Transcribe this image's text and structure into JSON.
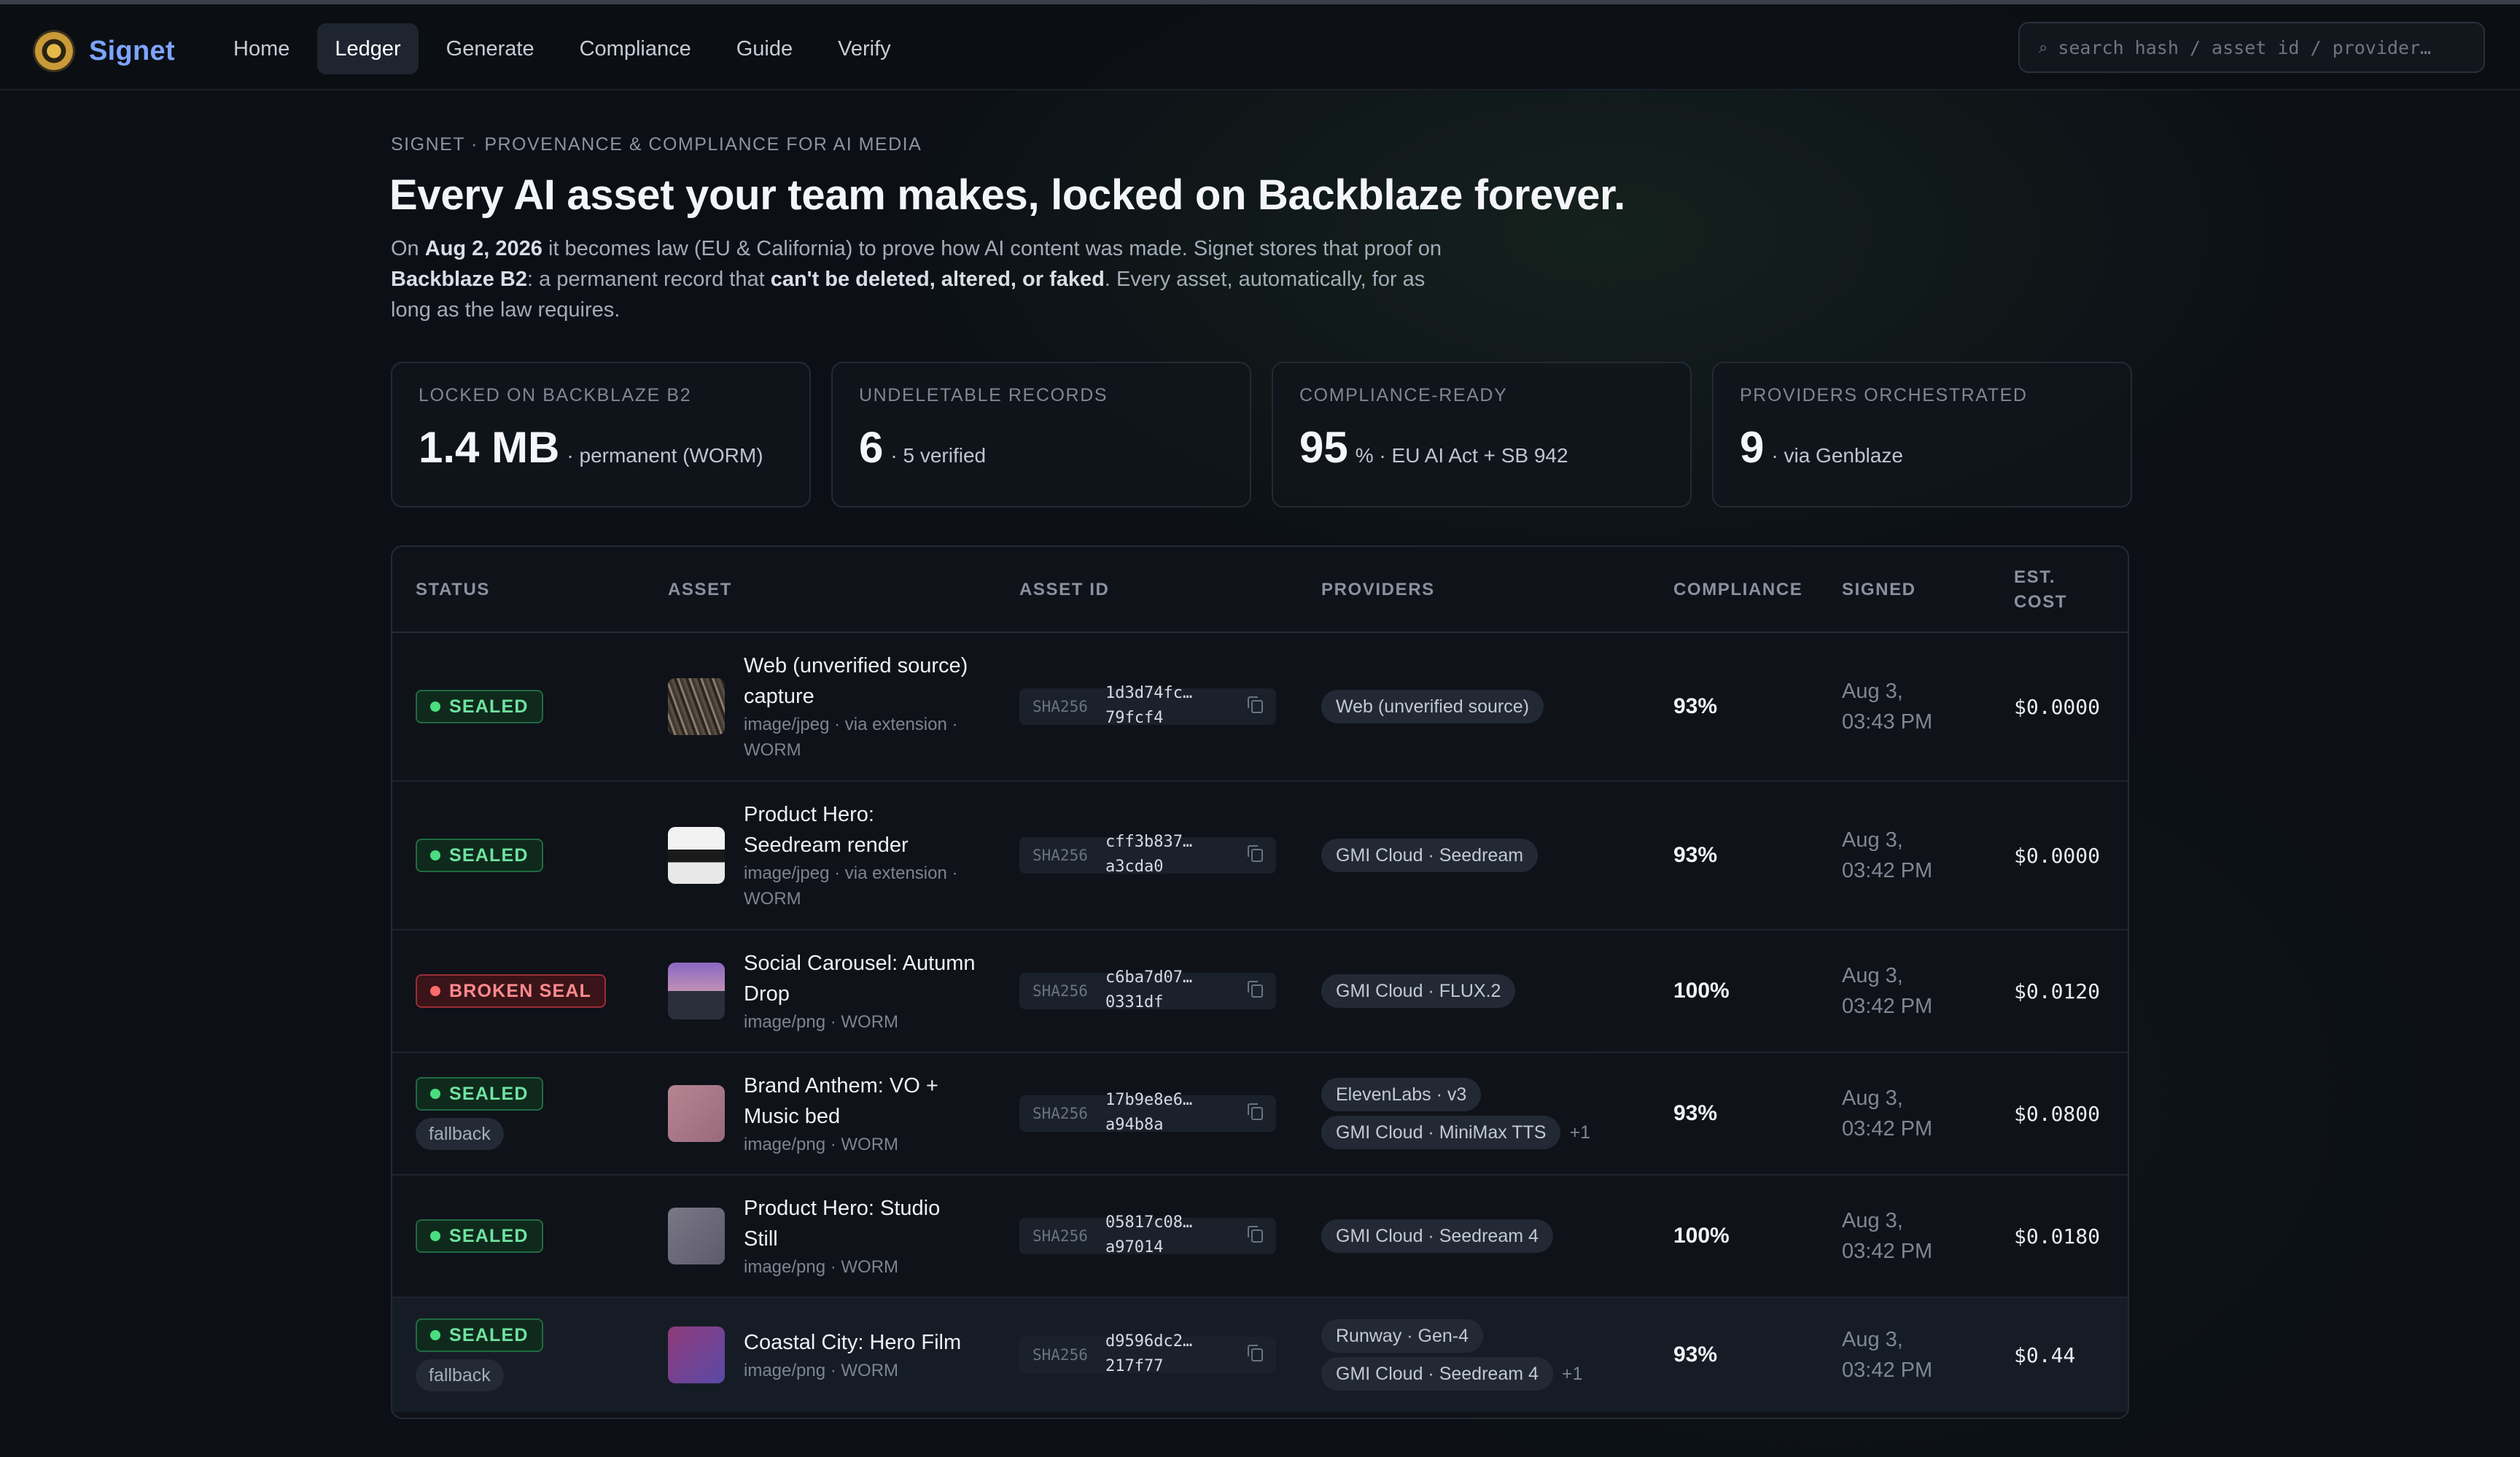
{
  "nav": {
    "brand": "Signet",
    "items": [
      "Home",
      "Ledger",
      "Generate",
      "Compliance",
      "Guide",
      "Verify"
    ],
    "active": "Ledger",
    "search_placeholder": "search hash / asset id / provider…",
    "icons": {
      "logo": "signet-seal-logo",
      "search": "search-icon"
    },
    "colors": {
      "brand": "#7ea4ff",
      "logo": "#e8b94a"
    }
  },
  "hero": {
    "eyebrow": "SIGNET · PROVENANCE & COMPLIANCE FOR AI MEDIA",
    "headline": "Every AI asset your team makes, locked on Backblaze forever.",
    "lede": [
      {
        "t": "On ",
        "b": false
      },
      {
        "t": "Aug 2, 2026",
        "b": true
      },
      {
        "t": " it becomes law (EU & California) to prove how AI content was made. Signet stores that proof on ",
        "b": false
      },
      {
        "t": "Backblaze B2",
        "b": true
      },
      {
        "t": ": a permanent record that ",
        "b": false
      },
      {
        "t": "can't be deleted, altered, or faked",
        "b": true
      },
      {
        "t": ". Every asset, automatically, for as long as the law requires.",
        "b": false
      }
    ]
  },
  "stats": [
    {
      "label": "LOCKED ON BACKBLAZE B2",
      "value": "1.4 MB",
      "suffix": "· permanent (WORM)"
    },
    {
      "label": "UNDELETABLE RECORDS",
      "value": "6",
      "suffix": "· 5 verified"
    },
    {
      "label": "COMPLIANCE-READY",
      "value": "95",
      "suffix": "% · EU AI Act + SB 942"
    },
    {
      "label": "PROVIDERS ORCHESTRATED",
      "value": "9",
      "suffix": "· via Genblaze"
    }
  ],
  "table": {
    "headers": {
      "status": "STATUS",
      "asset": "ASSET",
      "asset_id": "ASSET ID",
      "providers": "PROVIDERS",
      "compliance": "COMPLIANCE",
      "signed": "SIGNED",
      "cost": "EST. COST"
    },
    "hash_label": "SHA256",
    "rows": [
      {
        "status": "SEALED",
        "status_kind": "sealed",
        "fallback": "",
        "title": "Web (unverified source) capture",
        "meta": "image/jpeg · via extension · WORM",
        "thumb": "crowd",
        "hash": [
          "1d3d74fc…",
          "79fcf4"
        ],
        "providers": [
          "Web (unverified source)"
        ],
        "more": "",
        "compliance": "93%",
        "signed": [
          "Aug 3,",
          "03:43 PM"
        ],
        "cost": "$0.0000"
      },
      {
        "status": "SEALED",
        "status_kind": "sealed",
        "fallback": "",
        "title": "Product Hero: Seedream render",
        "meta": "image/jpeg · via extension · WORM",
        "thumb": "product",
        "hash": [
          "cff3b837…",
          "a3cda0"
        ],
        "providers": [
          "GMI Cloud · Seedream"
        ],
        "more": "",
        "compliance": "93%",
        "signed": [
          "Aug 3,",
          "03:42 PM"
        ],
        "cost": "$0.0000"
      },
      {
        "status": "BROKEN SEAL",
        "status_kind": "broken",
        "fallback": "",
        "title": "Social Carousel: Autumn Drop",
        "meta": "image/png · WORM",
        "thumb": "purple-split",
        "hash": [
          "c6ba7d07…",
          "0331df"
        ],
        "providers": [
          "GMI Cloud · FLUX.2"
        ],
        "more": "",
        "compliance": "100%",
        "signed": [
          "Aug 3,",
          "03:42 PM"
        ],
        "cost": "$0.0120"
      },
      {
        "status": "SEALED",
        "status_kind": "sealed",
        "fallback": "fallback",
        "title": "Brand Anthem: VO + Music bed",
        "meta": "image/png · WORM",
        "thumb": "pink",
        "hash": [
          "17b9e8e6…",
          "a94b8a"
        ],
        "providers": [
          "ElevenLabs · v3",
          "GMI Cloud · MiniMax TTS"
        ],
        "more": "+1",
        "compliance": "93%",
        "signed": [
          "Aug 3,",
          "03:42 PM"
        ],
        "cost": "$0.0800"
      },
      {
        "status": "SEALED",
        "status_kind": "sealed",
        "fallback": "",
        "title": "Product Hero: Studio Still",
        "meta": "image/png · WORM",
        "thumb": "grey-violet",
        "hash": [
          "05817c08…",
          "a97014"
        ],
        "providers": [
          "GMI Cloud · Seedream 4"
        ],
        "more": "",
        "compliance": "100%",
        "signed": [
          "Aug 3,",
          "03:42 PM"
        ],
        "cost": "$0.0180"
      },
      {
        "status": "SEALED",
        "status_kind": "sealed",
        "fallback": "fallback",
        "title": "Coastal City: Hero Film",
        "meta": "image/png · WORM",
        "thumb": "magenta-blue",
        "hash": [
          "d9596dc2…",
          "217f77"
        ],
        "providers": [
          "Runway · Gen-4",
          "GMI Cloud · Seedream 4"
        ],
        "more": "+1",
        "compliance": "93%",
        "signed": [
          "Aug 3,",
          "03:42 PM"
        ],
        "cost": "$0.44"
      }
    ]
  },
  "colors": {
    "sealed": "#4ade80",
    "broken": "#ff6b6b",
    "background": "#0c1016"
  }
}
